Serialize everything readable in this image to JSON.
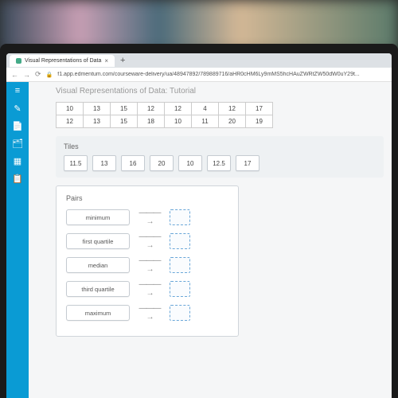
{
  "browser": {
    "tab_title": "Visual Representations of Data",
    "tab_close": "×",
    "new_tab": "+",
    "nav_back": "←",
    "nav_fwd": "→",
    "nav_reload": "⟳",
    "lock": "🔒",
    "url": "f1.app.edmentum.com/courseware-delivery/ua/48947892/789889716/aHR0cHM6Ly9mMS5hcHAuZWRtZW50dW0uY29t..."
  },
  "page": {
    "title": "Visual Representations of Data: Tutorial"
  },
  "sidebar_icons": [
    "≡",
    "✎",
    "📄",
    "🗂",
    "▦",
    "📋"
  ],
  "data_table": {
    "rows": [
      [
        "10",
        "13",
        "15",
        "12",
        "12",
        "4",
        "12",
        "17"
      ],
      [
        "12",
        "13",
        "15",
        "18",
        "10",
        "11",
        "20",
        "19"
      ]
    ]
  },
  "tiles": {
    "title": "Tiles",
    "values": [
      "11.5",
      "13",
      "16",
      "20",
      "10",
      "12.5",
      "17"
    ]
  },
  "pairs": {
    "title": "Pairs",
    "items": [
      {
        "label": "minimum"
      },
      {
        "label": "first quartile"
      },
      {
        "label": "median"
      },
      {
        "label": "third quartile"
      },
      {
        "label": "maximum"
      }
    ]
  },
  "arrow_glyph": "———→"
}
